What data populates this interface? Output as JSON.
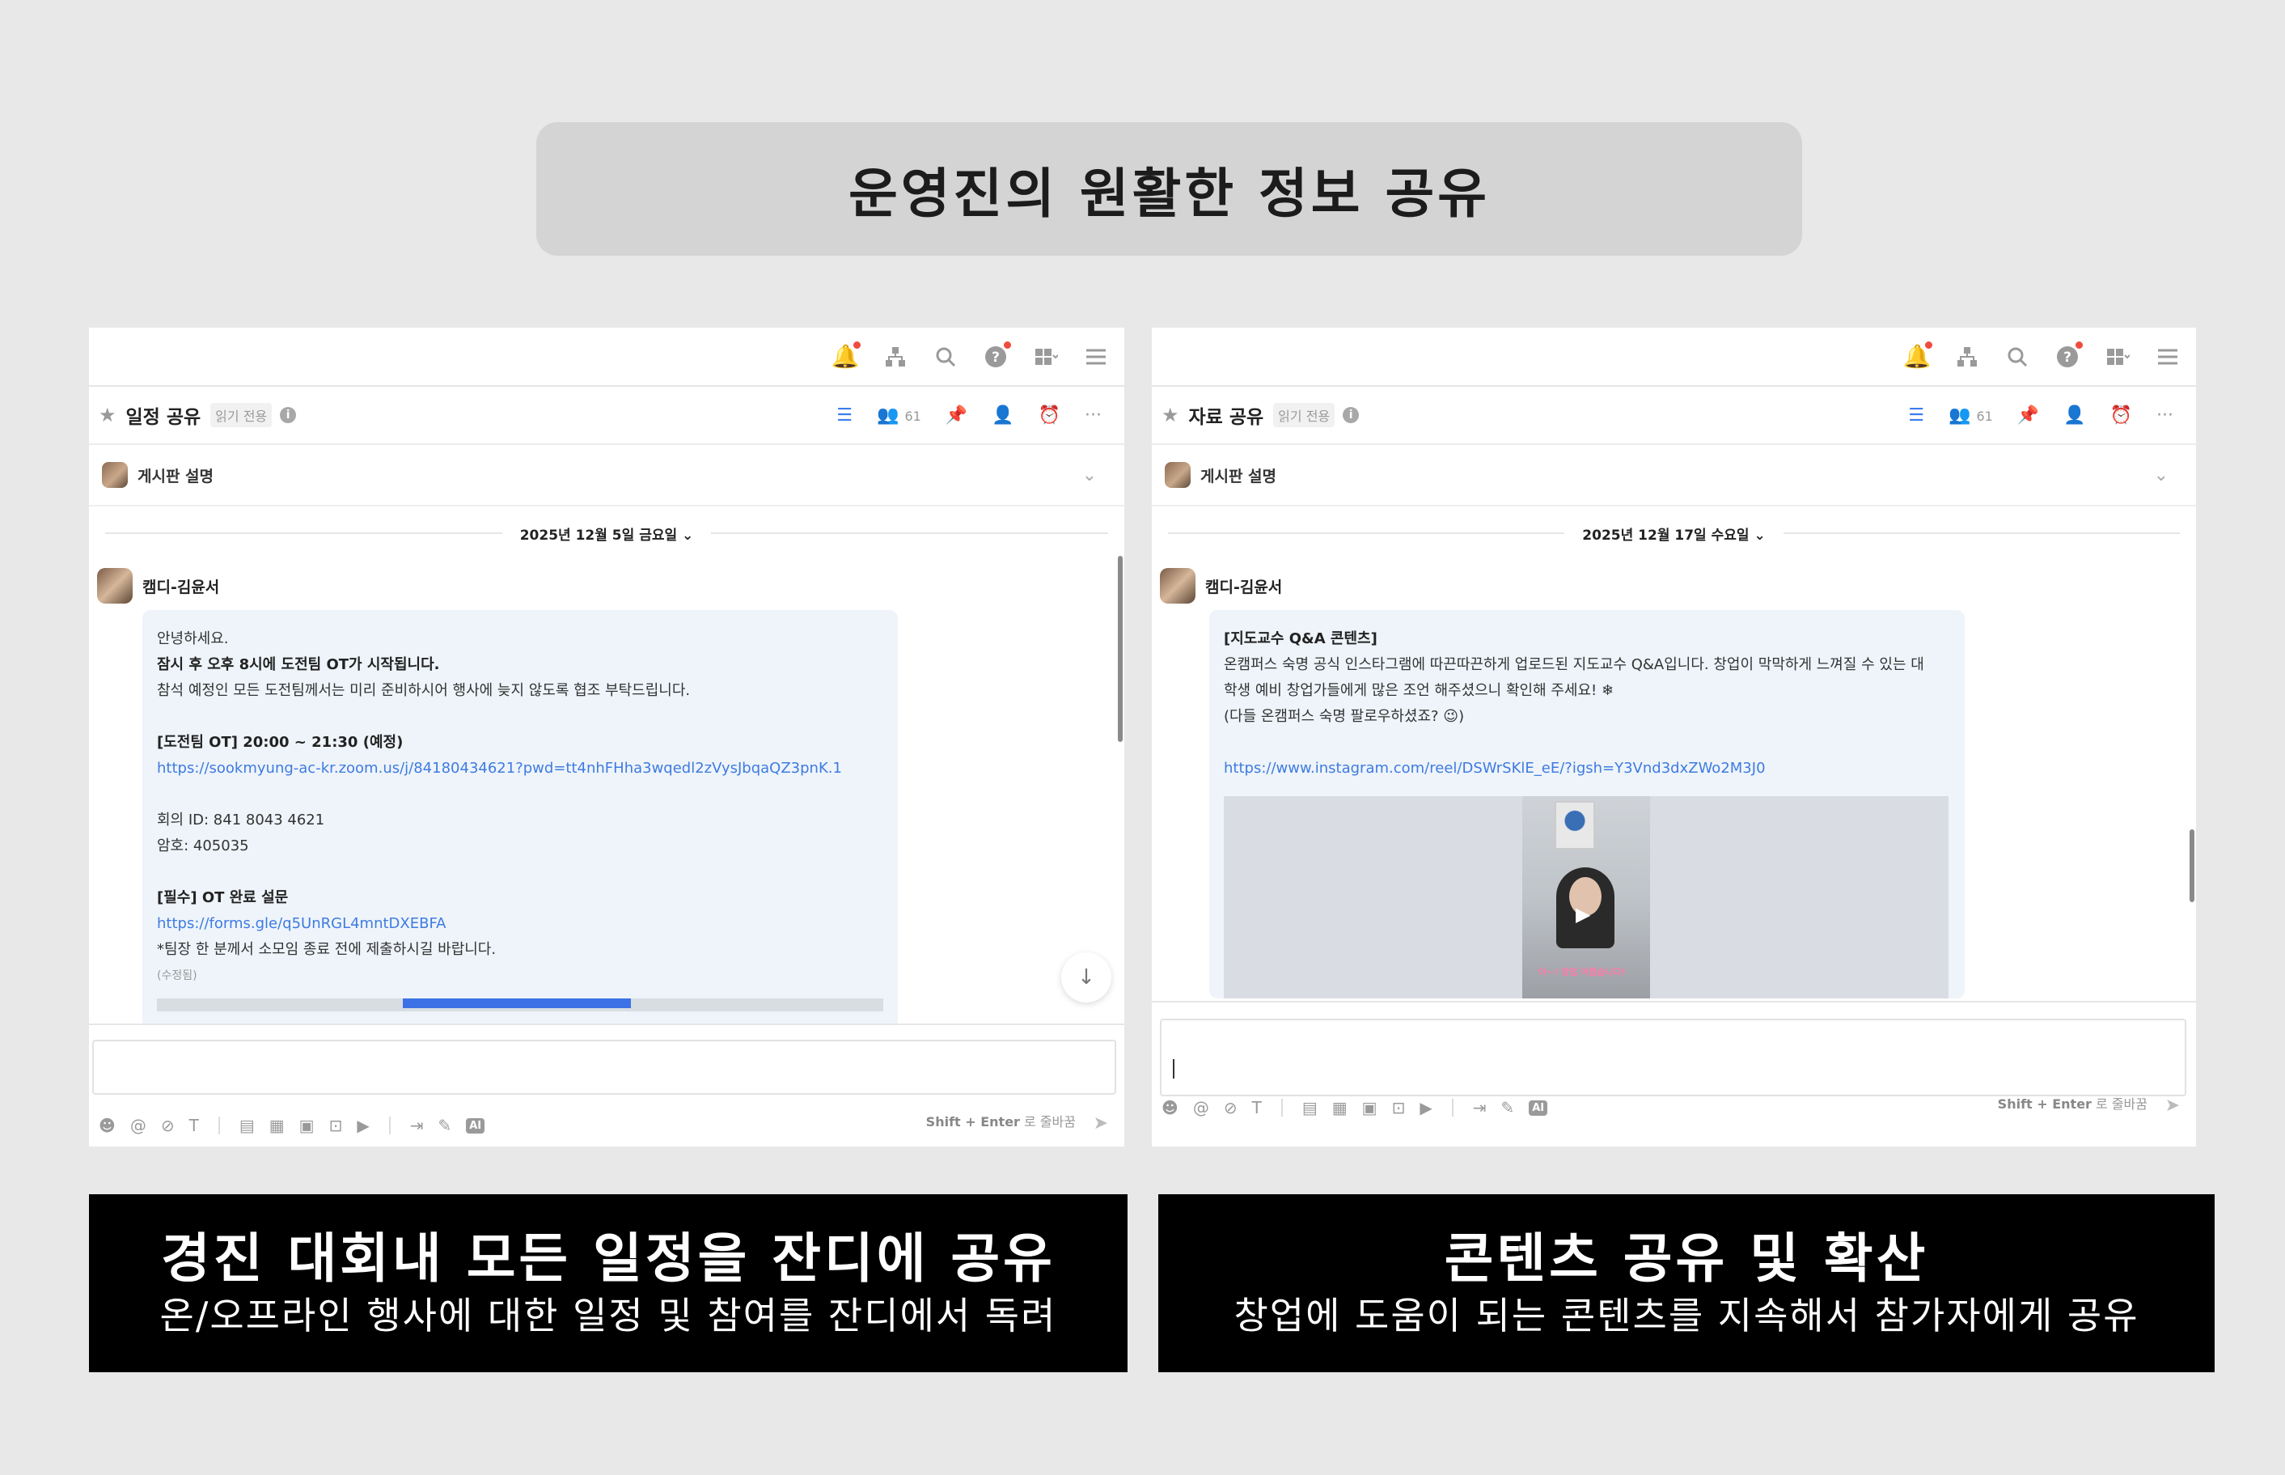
{
  "headline": "운영진의 원활한 정보 공유",
  "common": {
    "read_only": "읽기 전용",
    "board_desc": "게시판 설명",
    "member_count": "61",
    "author": "캠디-김윤서",
    "send_hint_keys": "Shift + Enter",
    "send_hint_text": "로 줄바꿈"
  },
  "left_panel": {
    "channel": "일정 공유",
    "date": "2025년 12월 5일 금요일",
    "lines": {
      "l1": "안녕하세요.",
      "l2": "잠시 후 오후 8시에 도전팀 OT가 시작됩니다.",
      "l3": "참석 예정인 모든 도전팀께서는 미리 준비하시어 행사에 늦지 않도록 협조 부탁드립니다.",
      "l4": "[도전팀 OT] 20:00 ~ 21:30 (예정)",
      "l5": "https://sookmyung-ac-kr.zoom.us/j/84180434621?pwd=tt4nhFHha3wqedl2zVysJbqaQZ3pnK.1",
      "l6": "회의 ID: 841 8043 4621",
      "l7": "암호: 405035",
      "l8": "[필수] OT 완료 설문",
      "l9": "https://forms.gle/q5UnRGL4mntDXEBFA",
      "l10": "*팀장 한 분께서 소모임 종료 전에 제출하시길 바랍니다.",
      "l11": "(수정됨)"
    }
  },
  "right_panel": {
    "channel": "자료 공유",
    "date": "2025년 12월 17일 수요일",
    "lines": {
      "l1": "[지도교수 Q&A 콘텐츠]",
      "l2": "온캠퍼스 숙명 공식 인스타그램에 따끈따끈하게 업로드된 지도교수 Q&A입니다. 창업이 막막하게 느껴질 수 있는 대",
      "l3": "학생 예비 창업가들에게 많은 조언 해주셨으니 확인해 주세요! ❄",
      "l4": "(다들 온캠퍼스 숙명 팔로우하셨죠? 😉)",
      "l5": "https://www.instagram.com/reel/DSWrSKlE_eE/?igsh=Y3Vnd3dxZWo2M3J0",
      "video_caption": "아~! 창업 어렵습니다!"
    }
  },
  "captions": {
    "left_title": "경진 대회내 모든 일정을 잔디에 공유",
    "left_sub": "온/오프라인 행사에 대한 일정 및 참여를 잔디에서 독려",
    "right_title": "콘텐츠 공유 및 확산",
    "right_sub": "창업에 도움이 되는 콘텐츠를 지속해서 참가자에게 공유"
  },
  "icons": [
    "bell-icon",
    "org-chart-icon",
    "search-icon",
    "help-icon",
    "apps-grid-icon",
    "menu-icon",
    "star-icon",
    "info-icon",
    "add-list-icon",
    "members-icon",
    "pin-icon",
    "invite-icon",
    "alarm-icon",
    "more-icon",
    "chevron-down-icon",
    "arrow-down-icon",
    "emoji-icon",
    "mention-icon",
    "attach-icon",
    "text-format-icon",
    "send-icon"
  ],
  "colors": {
    "accent": "#3f7be0",
    "notification": "#f04c3e",
    "caption_bg": "#000000",
    "headline_bg": "#d4d4d4"
  }
}
